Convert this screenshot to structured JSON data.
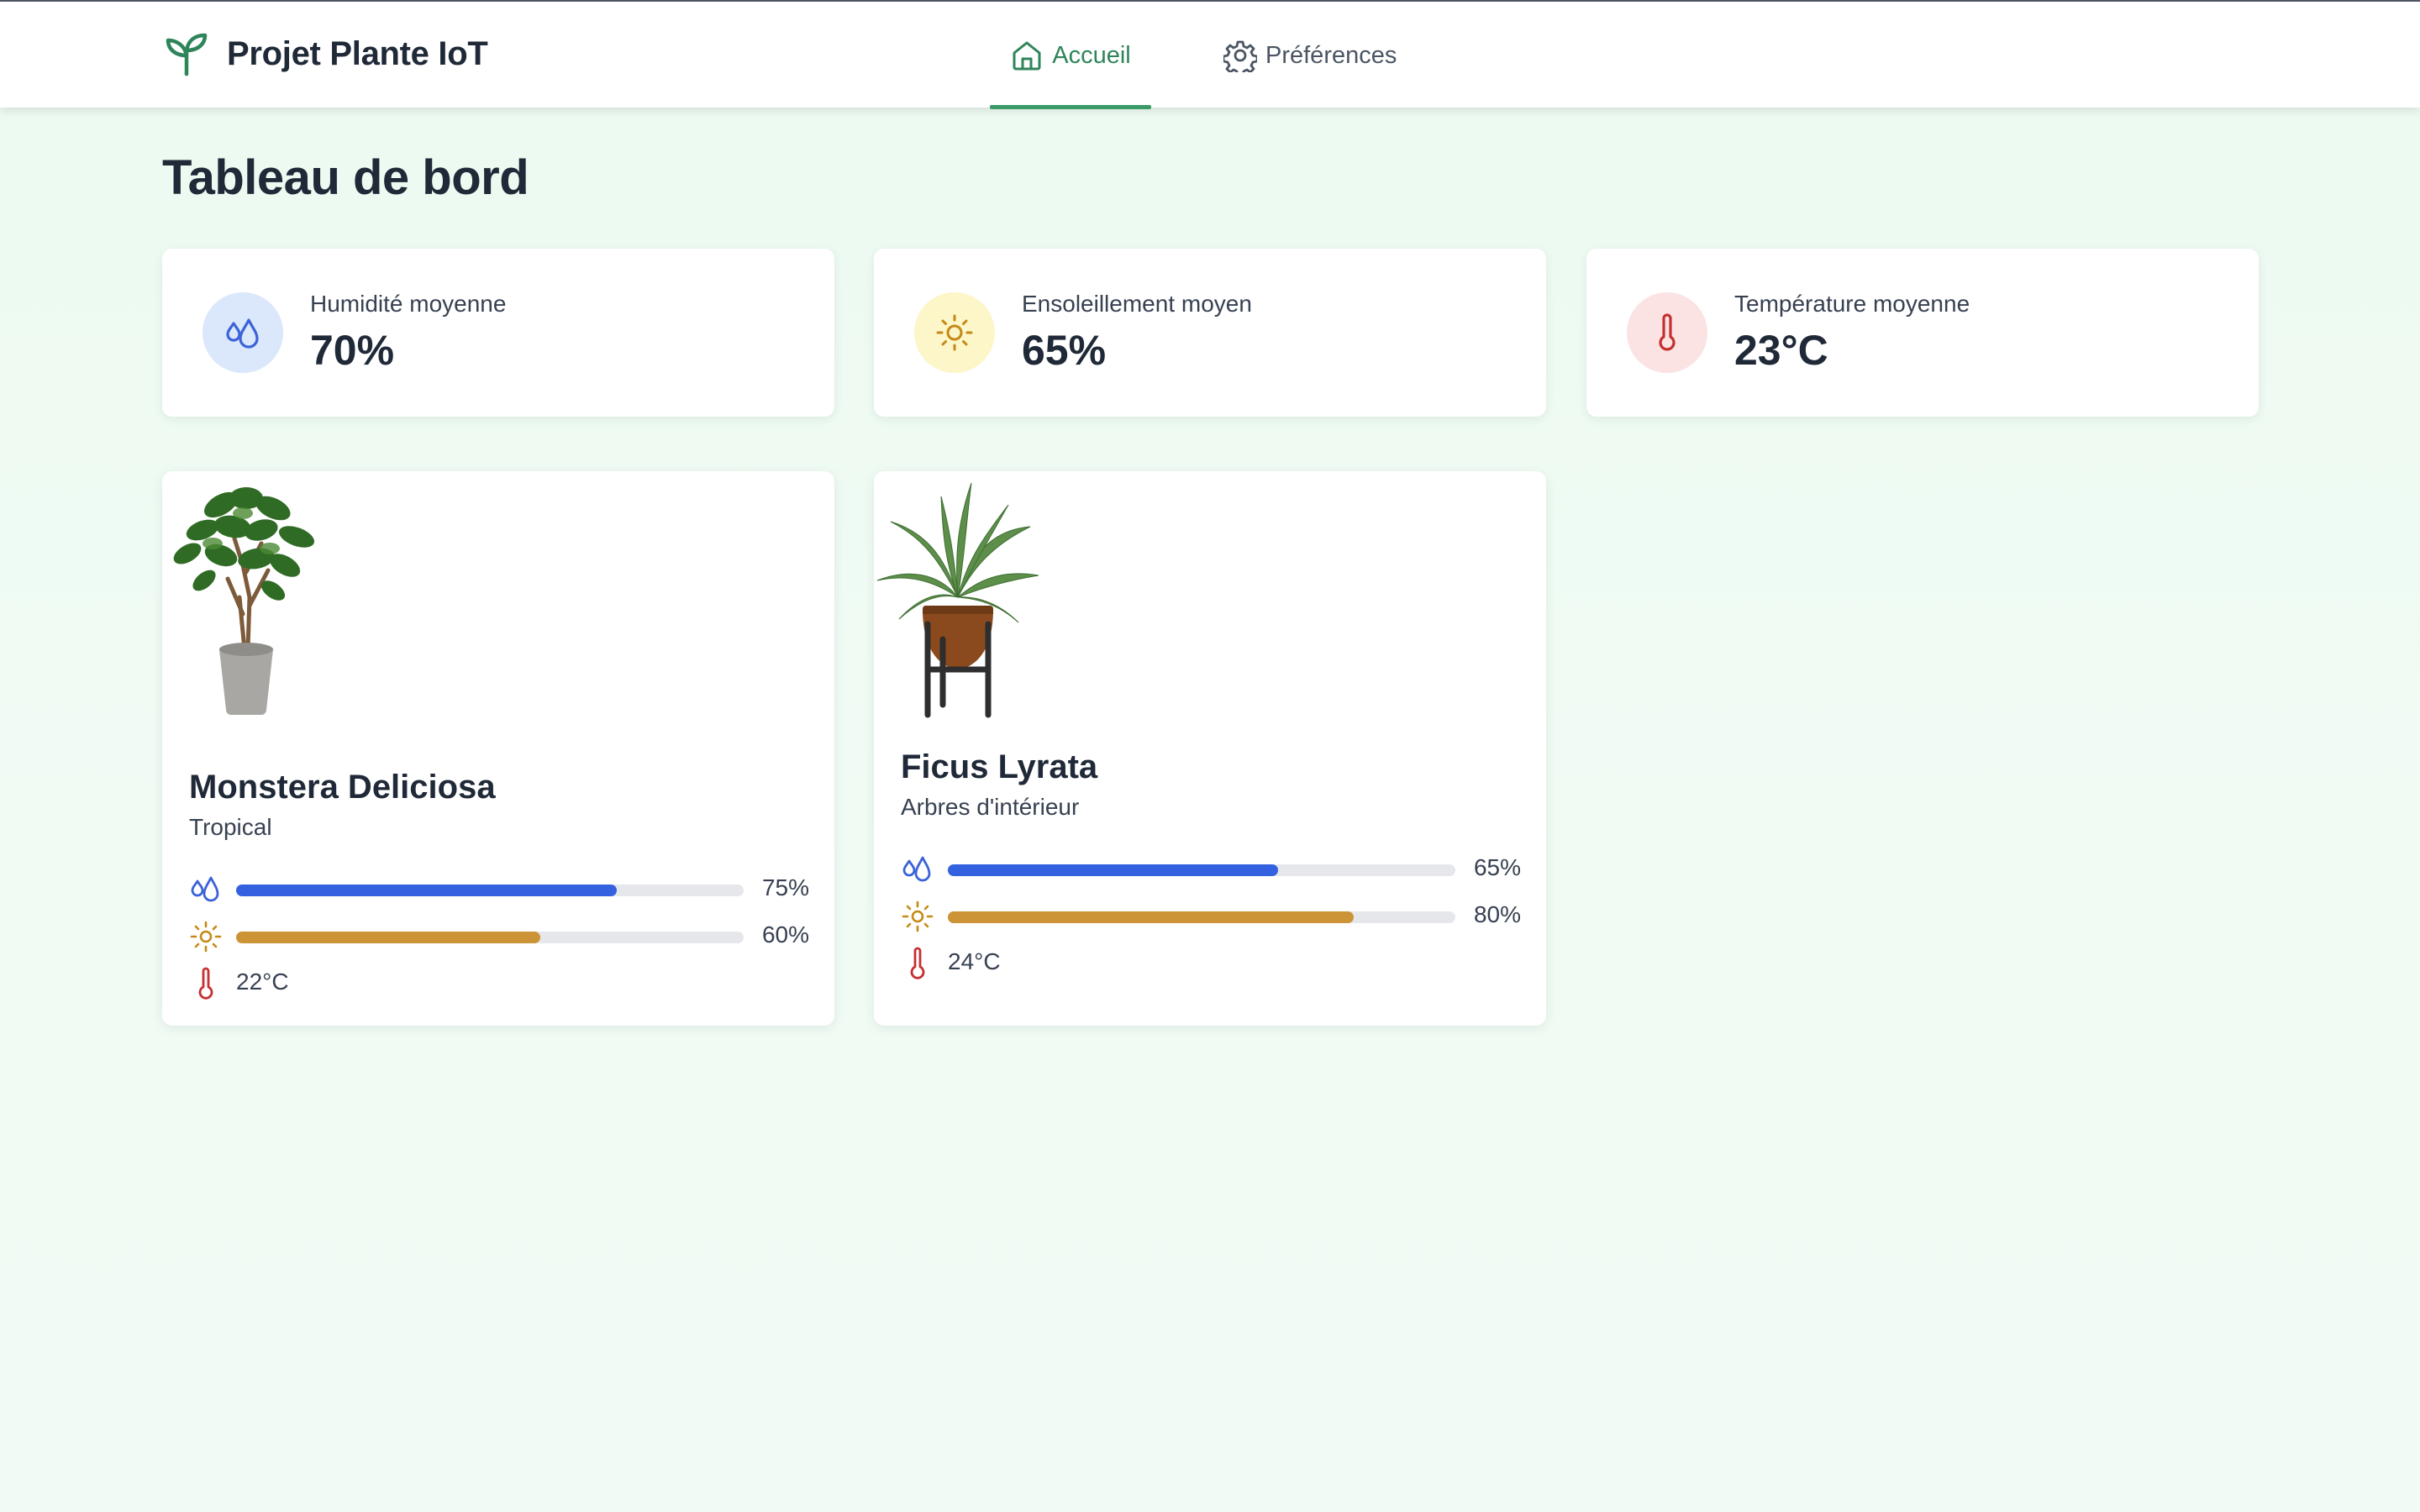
{
  "app": {
    "title": "Projet Plante IoT",
    "logo_icon": "sprout-icon",
    "accent": "#3a9b69"
  },
  "nav": {
    "items": [
      {
        "label": "Accueil",
        "icon": "home-icon",
        "active": true
      },
      {
        "label": "Préférences",
        "icon": "gear-icon",
        "active": false
      }
    ]
  },
  "page": {
    "title": "Tableau de bord"
  },
  "stats": [
    {
      "label": "Humidité moyenne",
      "value": "70%",
      "icon": "water-drops-icon",
      "icon_color": "#3b63d8",
      "bg": "#dbe7fb"
    },
    {
      "label": "Ensoleillement moyen",
      "value": "65%",
      "icon": "sun-icon",
      "icon_color": "#c58a16",
      "bg": "#fdf6c9"
    },
    {
      "label": "Température moyenne",
      "value": "23°C",
      "icon": "thermometer-icon",
      "icon_color": "#c53030",
      "bg": "#fbe3e3"
    }
  ],
  "plants": [
    {
      "name": "Monstera Deliciosa",
      "category": "Tropical",
      "humidity": {
        "percent": 75,
        "label": "75%",
        "color": "#3461e0"
      },
      "sunlight": {
        "percent": 60,
        "label": "60%",
        "color": "#cc9436"
      },
      "temperature": "22°C"
    },
    {
      "name": "Ficus Lyrata",
      "category": "Arbres d'intérieur",
      "humidity": {
        "percent": 65,
        "label": "65%",
        "color": "#3461e0"
      },
      "sunlight": {
        "percent": 80,
        "label": "80%",
        "color": "#cc9436"
      },
      "temperature": "24°C"
    }
  ]
}
